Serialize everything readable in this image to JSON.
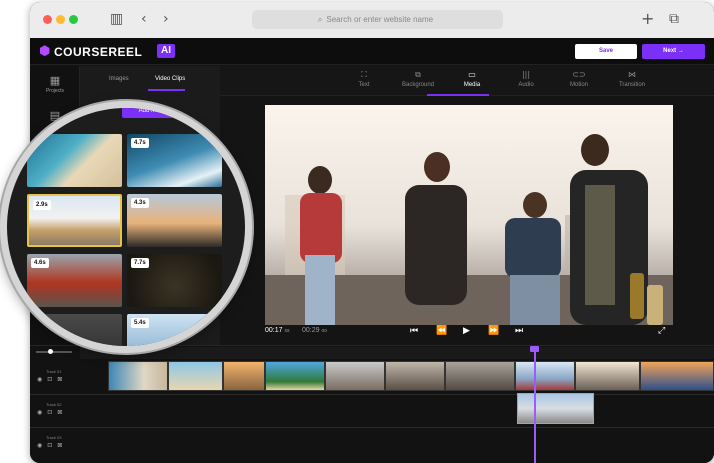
{
  "browser": {
    "url_placeholder": "Search or enter website name",
    "icons": [
      "sidebar-icon",
      "back-icon",
      "forward-icon",
      "search-icon",
      "new-tab-icon",
      "tabs-icon"
    ]
  },
  "app": {
    "logo_text": "COURSEREEL",
    "logo_ai": "AI",
    "save_label": "Save",
    "next_label": "Next →",
    "accent_color": "#7b2ff7"
  },
  "rail": {
    "items": [
      {
        "label": "Projects",
        "icon": "grid-icon"
      },
      {
        "label": "",
        "icon": "document-icon"
      }
    ]
  },
  "media_panel": {
    "tabs": [
      {
        "label": "Images",
        "active": false
      },
      {
        "label": "Video Clips",
        "active": true
      }
    ],
    "add_button": "Add Media",
    "clips": [
      {
        "duration": ""
      },
      {
        "duration": "4.7s"
      },
      {
        "duration": "2.9s",
        "selected": true
      },
      {
        "duration": "4.3s"
      },
      {
        "duration": "4.6s"
      },
      {
        "duration": "7.7s"
      },
      {
        "duration": ""
      },
      {
        "duration": "5.4s"
      }
    ]
  },
  "tool_tabs": [
    {
      "label": "Text",
      "icon": "text-icon"
    },
    {
      "label": "Background",
      "icon": "background-icon"
    },
    {
      "label": "Media",
      "icon": "media-icon",
      "active": true
    },
    {
      "label": "Audio",
      "icon": "audio-icon"
    },
    {
      "label": "Motion",
      "icon": "motion-icon"
    },
    {
      "label": "Transition",
      "icon": "transition-icon"
    }
  ],
  "player": {
    "current_time": "00:17",
    "current_unit": "ss",
    "total_time": "00:29",
    "total_unit": "oo",
    "controls": [
      "skip-back-icon",
      "rewind-icon",
      "play-icon",
      "fast-forward-icon",
      "skip-forward-icon"
    ],
    "fullscreen_icon": "fullscreen-icon"
  },
  "timeline": {
    "tracks": [
      {
        "label": "Track 01"
      },
      {
        "label": "Track 02"
      },
      {
        "label": "Track 03"
      }
    ]
  }
}
